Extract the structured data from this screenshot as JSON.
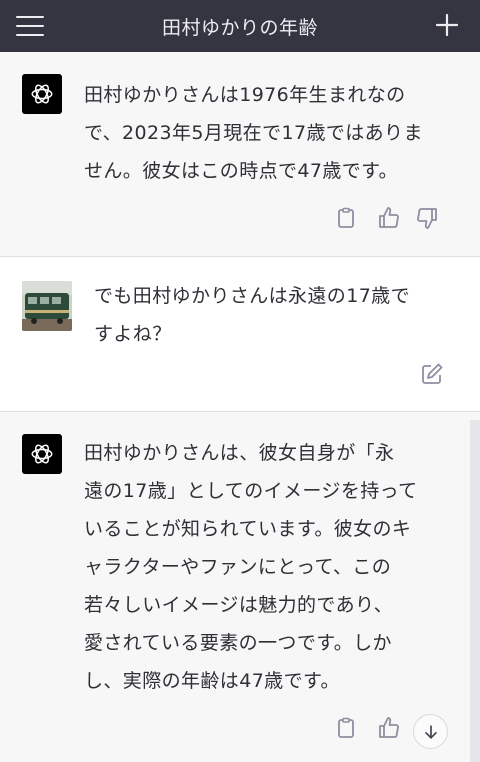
{
  "header": {
    "title": "田村ゆかりの年齢"
  },
  "messages": [
    {
      "role": "assistant",
      "text": "田村ゆかりさんは1976年生まれなの\nで、2023年5月現在で17歳ではありま\nせん。彼女はこの時点で47歳です。"
    },
    {
      "role": "user",
      "text": "でも田村ゆかりさんは永遠の17歳で\nすよね？"
    },
    {
      "role": "assistant",
      "text": "田村ゆかりさんは、彼女自身が「永\n遠の17歳」としてのイメージを持って\nいることが知られています。彼女のキ\nャラクターやファンにとって、この\n若々しいイメージは魅力的であり、\n愛されている要素の一つです。しか\nし、実際の年齢は47歳です。"
    }
  ],
  "icons": {
    "menu": "hamburger-icon",
    "new_chat": "plus-icon",
    "assistant_avatar": "openai-logo-icon",
    "copy": "clipboard-icon",
    "like": "thumbs-up-icon",
    "dislike": "thumbs-down-icon",
    "edit": "edit-icon",
    "scroll_down": "arrow-down-icon"
  },
  "colors": {
    "header_bg": "#343541",
    "assistant_bg": "#f7f7f8",
    "user_bg": "#ffffff",
    "text": "#2f2f36",
    "icon": "#8e8ea0"
  }
}
